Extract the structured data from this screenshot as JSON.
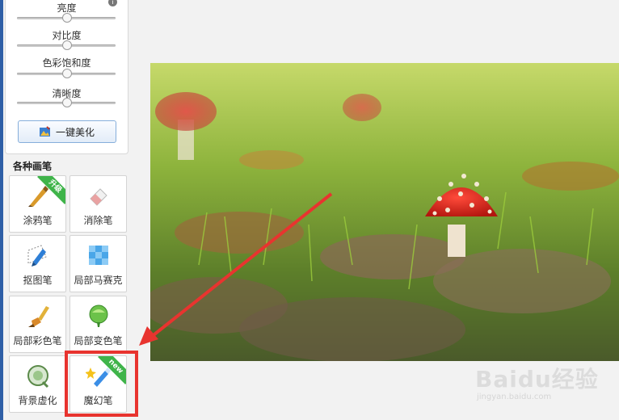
{
  "adjustments": {
    "brightness": {
      "label": "亮度",
      "level": 0.5
    },
    "contrast": {
      "label": "对比度",
      "level": 0.5
    },
    "saturation": {
      "label": "色彩饱和度",
      "level": 0.5
    },
    "sharpness": {
      "label": "清晰度",
      "level": 0.5
    }
  },
  "beautify_button": "一键美化",
  "brushes": {
    "title": "各种画笔",
    "items": [
      {
        "label": "涂鸦笔",
        "badge": "升级",
        "icon": "crayon-icon"
      },
      {
        "label": "消除笔",
        "badge": "",
        "icon": "eraser-icon"
      },
      {
        "label": "抠图笔",
        "badge": "",
        "icon": "cutout-pen-icon"
      },
      {
        "label": "局部马赛克",
        "badge": "",
        "icon": "mosaic-icon"
      },
      {
        "label": "局部彩色笔",
        "badge": "",
        "icon": "color-brush-icon"
      },
      {
        "label": "局部变色笔",
        "badge": "",
        "icon": "color-change-icon"
      },
      {
        "label": "背景虚化",
        "badge": "",
        "icon": "blur-lens-icon"
      },
      {
        "label": "魔幻笔",
        "badge": "new",
        "icon": "magic-pen-icon"
      }
    ]
  },
  "watermark": {
    "text": "Baidu经验",
    "sub": "jingyan.baidu.com"
  },
  "colors": {
    "accent": "#e8342f",
    "badge": "#3fb44a",
    "button_border": "#86aedb"
  }
}
